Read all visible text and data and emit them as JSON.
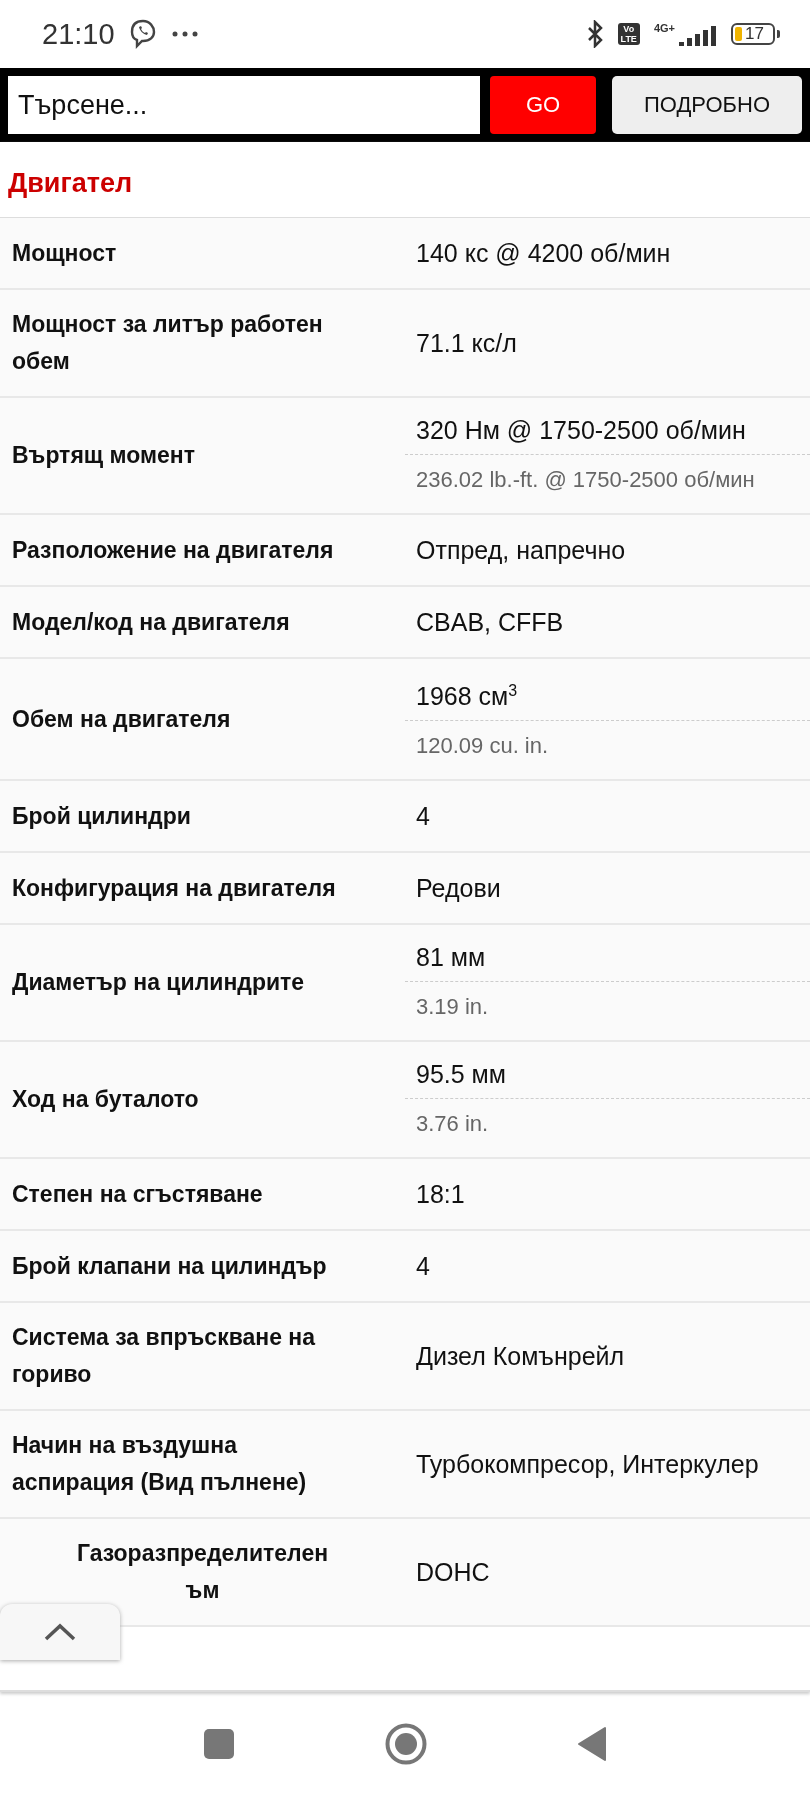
{
  "status_bar": {
    "time": "21:10",
    "volte": [
      "Vo",
      "LTE"
    ],
    "network": "4G+",
    "battery": {
      "text": "17",
      "level": 0.17
    }
  },
  "search": {
    "placeholder": "Търсене...",
    "go": "GO",
    "details": "ПОДРОБНО"
  },
  "section": {
    "title": "Двигател"
  },
  "rows": [
    {
      "label": "Мощност",
      "values": [
        {
          "text": "140 кс @ 4200 об/мин",
          "kind": "main"
        }
      ]
    },
    {
      "label": "Мощност за литър работен обем",
      "values": [
        {
          "text": "71.1 кс/л",
          "kind": "main"
        }
      ]
    },
    {
      "label": "Въртящ момент",
      "values": [
        {
          "text": "320 Нм @ 1750-2500 об/мин",
          "kind": "main"
        },
        {
          "text": "236.02 lb.-ft. @ 1750-2500 об/мин",
          "kind": "alt"
        }
      ]
    },
    {
      "label": "Разположение на двигателя",
      "values": [
        {
          "text": "Отпред, напречно",
          "kind": "main"
        }
      ]
    },
    {
      "label": "Модел/код на двигателя",
      "values": [
        {
          "text": "CBAB, CFFB",
          "kind": "main"
        }
      ]
    },
    {
      "label": "Обем на двигателя",
      "values": [
        {
          "text": "1968 см$^{3}$",
          "kind": "main"
        },
        {
          "text": "120.09 cu. in.",
          "kind": "alt"
        }
      ]
    },
    {
      "label": "Брой цилиндри",
      "values": [
        {
          "text": "4",
          "kind": "main"
        }
      ]
    },
    {
      "label": "Конфигурация на двигателя",
      "values": [
        {
          "text": "Редови",
          "kind": "main"
        }
      ]
    },
    {
      "label": "Диаметър на цилиндрите",
      "values": [
        {
          "text": "81 мм",
          "kind": "main"
        },
        {
          "text": "3.19 in.",
          "kind": "alt"
        }
      ]
    },
    {
      "label": "Ход на буталото",
      "values": [
        {
          "text": "95.5 мм",
          "kind": "main"
        },
        {
          "text": "3.76 in.",
          "kind": "alt"
        }
      ]
    },
    {
      "label": "Степен на сгъстяване",
      "values": [
        {
          "text": "18:1",
          "kind": "main"
        }
      ]
    },
    {
      "label": "Брой клапани на цилиндър",
      "values": [
        {
          "text": "4",
          "kind": "main"
        }
      ]
    },
    {
      "label": "Система за впръскване на гориво",
      "values": [
        {
          "text": "Дизел Комънрейл",
          "kind": "main"
        }
      ]
    },
    {
      "label": "Начин на въздушна аспирация (Вид пълнене)",
      "values": [
        {
          "text": "Турбокомпресор, Интеркулер",
          "kind": "main"
        }
      ]
    },
    {
      "label": "Газоразпределителен",
      "label_tail": "ъм",
      "values": [
        {
          "text": "DOHC",
          "kind": "main"
        }
      ]
    }
  ]
}
